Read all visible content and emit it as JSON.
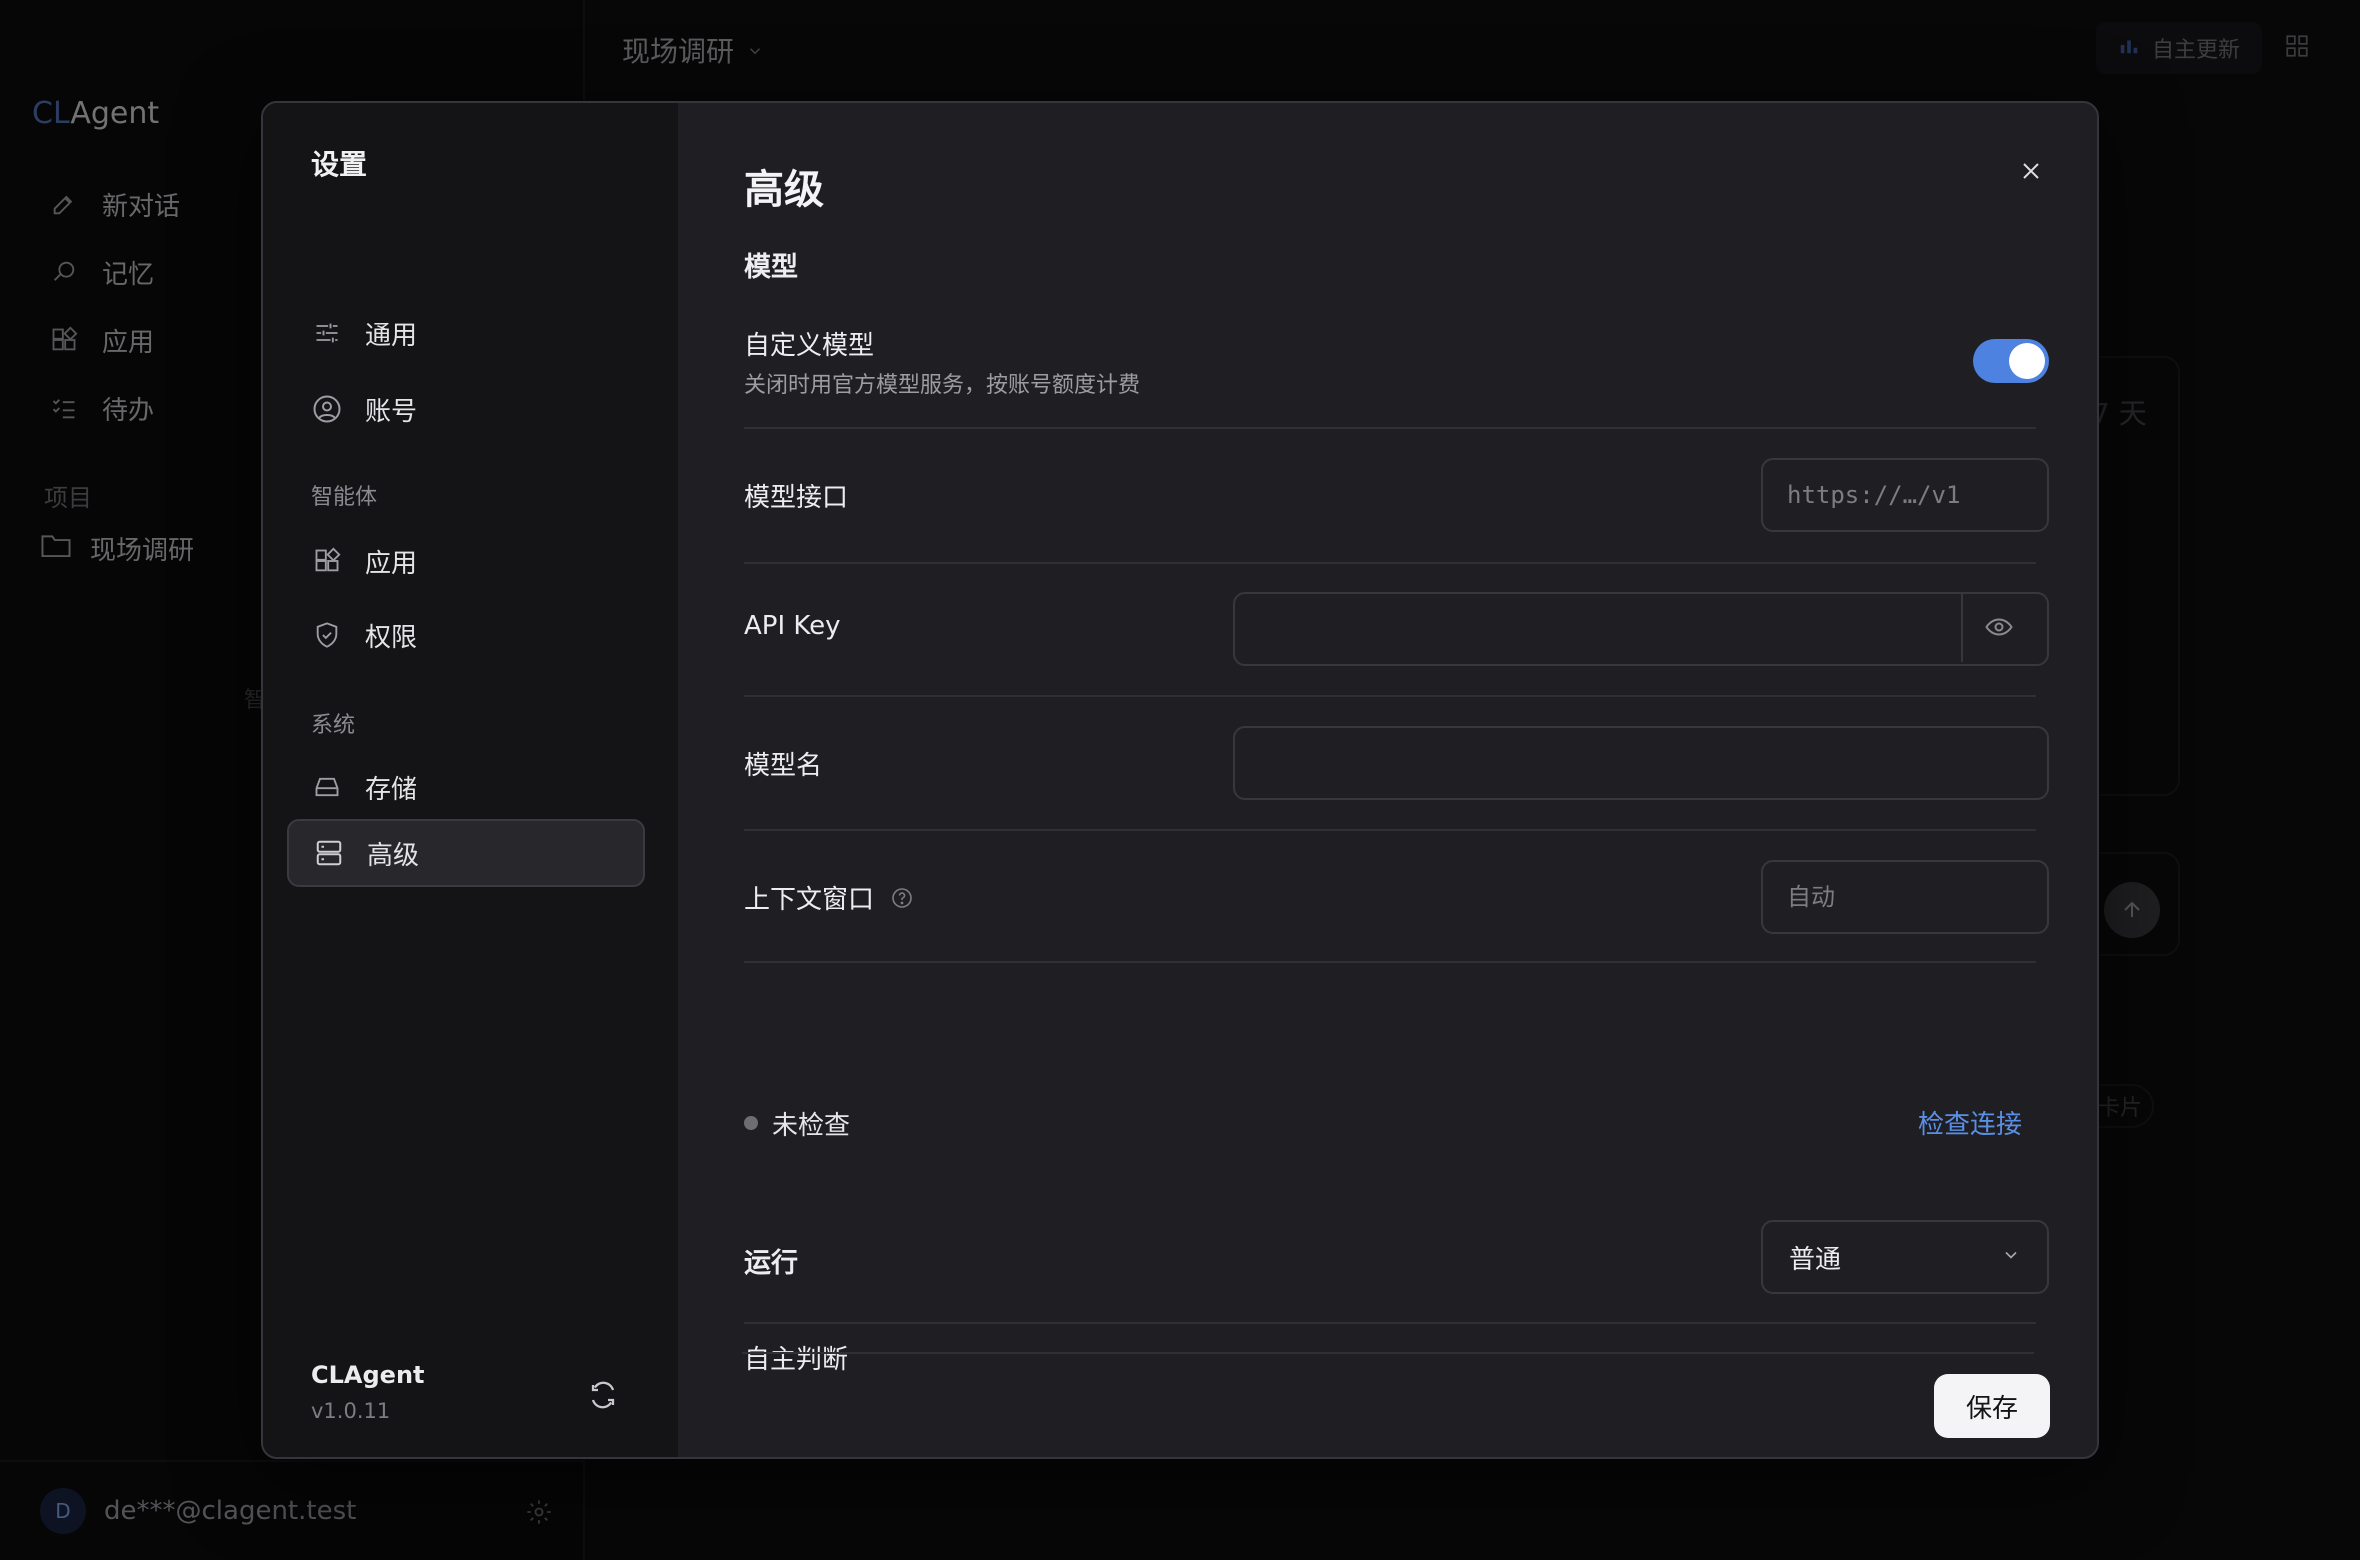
{
  "app": {
    "logo_prefix": "CL",
    "logo_suffix": "Agent",
    "nav": [
      {
        "label": "新对话",
        "icon": "edit-icon"
      },
      {
        "label": "记忆",
        "icon": "memory-icon"
      },
      {
        "label": "应用",
        "icon": "apps-icon"
      },
      {
        "label": "待办",
        "icon": "todo-icon"
      }
    ],
    "projects_label": "项目",
    "project_name": "现场调研",
    "stray_text": "智",
    "user_initial": "D",
    "user_email": "de***@clagent.test",
    "header_title": "现场调研",
    "autoupdate_label": "自主更新",
    "bg_card_text": "7 天",
    "bg_chip_text": "卡片"
  },
  "settings": {
    "title": "设置",
    "nav": {
      "general": "通用",
      "account": "账号",
      "agents_label": "智能体",
      "apps": "应用",
      "permissions": "权限",
      "system_label": "系统",
      "storage": "存储",
      "advanced": "高级"
    },
    "app_name": "CLAgent",
    "version": "v1.0.11"
  },
  "panel": {
    "title": "高级",
    "model_section": "模型",
    "custom_model": {
      "label": "自定义模型",
      "description": "关闭时用官方模型服务，按账号额度计费",
      "enabled": true
    },
    "endpoint": {
      "label": "模型接口",
      "placeholder": "https://…/v1",
      "value": ""
    },
    "api_key": {
      "label": "API Key",
      "value": ""
    },
    "model_name": {
      "label": "模型名",
      "value": ""
    },
    "context_window": {
      "label": "上下文窗口",
      "placeholder": "自动",
      "value": ""
    },
    "status": "未检查",
    "check_connection": "检查连接",
    "run_section": "运行",
    "autonomy": {
      "label": "自主判断",
      "selected": "普通"
    },
    "save": "保存"
  },
  "colors": {
    "accent": "#4e82e0",
    "link": "#5b8fe6",
    "status_idle": "#6d6d73"
  }
}
